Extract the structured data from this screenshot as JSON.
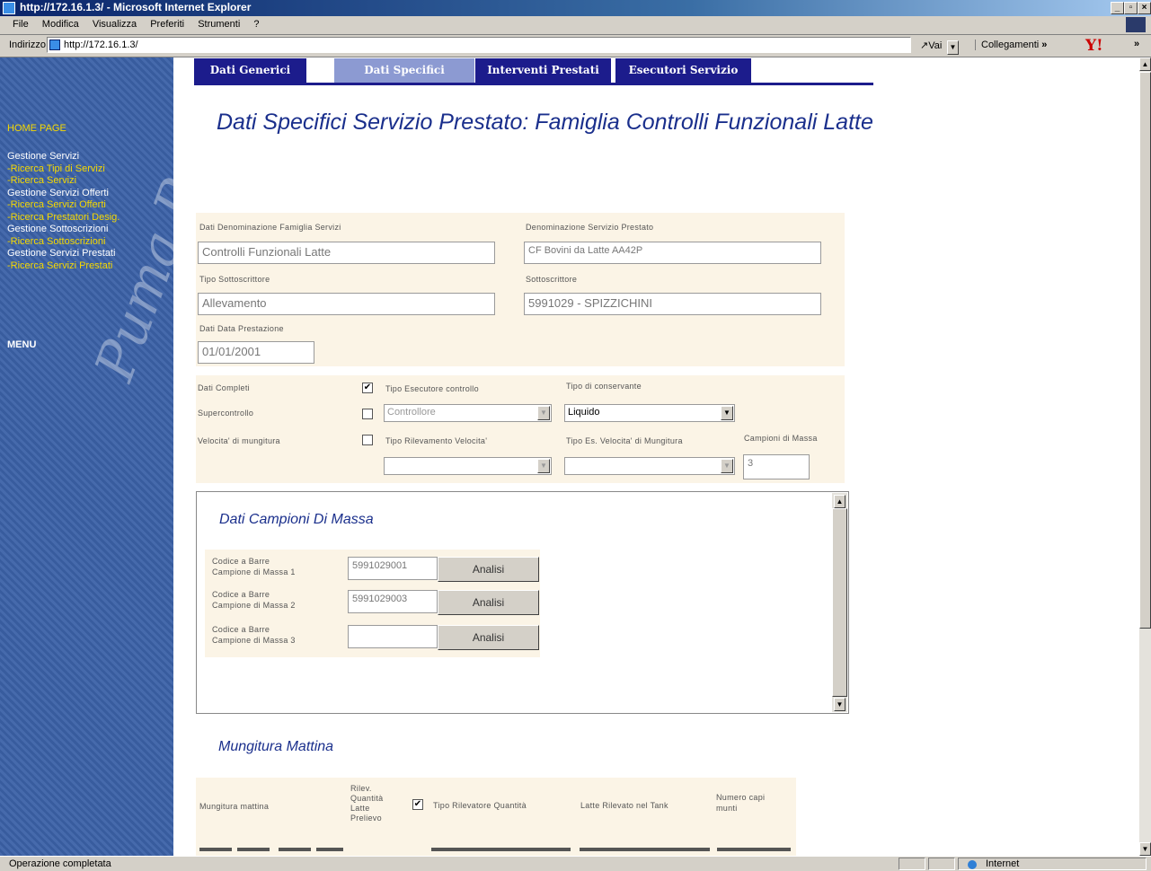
{
  "window": {
    "title": "http://172.16.1.3/ - Microsoft Internet Explorer"
  },
  "menu": [
    "File",
    "Modifica",
    "Visualizza",
    "Preferiti",
    "Strumenti",
    "?"
  ],
  "addressbar": {
    "label": "Indirizzo",
    "url": "http://172.16.1.3/",
    "go_label": "Vai",
    "links_label": "Collegamenti",
    "chevron": "»"
  },
  "sidebar": {
    "home": "HOME PAGE",
    "items": [
      {
        "label": "Gestione Servizi",
        "style": "white"
      },
      {
        "label": "-Ricerca Tipi di Servizi",
        "style": "yellow"
      },
      {
        "label": "-Ricerca Servizi",
        "style": "yellow"
      },
      {
        "label": "Gestione Servizi Offerti",
        "style": "white"
      },
      {
        "label": "-Ricerca Servizi Offerti",
        "style": "yellow"
      },
      {
        "label": "-Ricerca Prestatori Desig.",
        "style": "yellow"
      },
      {
        "label": "Gestione Sottoscrizioni",
        "style": "white"
      },
      {
        "label": "-Ricerca Sottoscrizioni",
        "style": "yellow"
      },
      {
        "label": "Gestione Servizi Prestati",
        "style": "white"
      },
      {
        "label": "-Ricerca Servizi Prestati",
        "style": "yellow"
      }
    ],
    "menu_label": "MENU",
    "watermark": "Puma Pr"
  },
  "tabs": [
    "Dati Generici",
    "Dati Specifici",
    "Interventi Prestati",
    "Esecutori Servizio"
  ],
  "page_title": "Dati Specifici Servizio Prestato: Famiglia Controlli Funzionali Latte",
  "general": {
    "famiglia_label": "Dati Denominazione Famiglia Servizi",
    "famiglia_value": "Controlli Funzionali  Latte",
    "servizio_label": "Denominazione Servizio Prestato",
    "servizio_value": "CF Bovini da Latte AA42P",
    "tipo_sott_label": "Tipo Sottoscrittore",
    "tipo_sott_value": "Allevamento",
    "sott_label": "Sottoscrittore",
    "sott_value": "5991029 - SPIZZICHINI",
    "data_label": "Dati Data Prestazione",
    "data_value": "01/01/2001"
  },
  "options": {
    "dati_completi_label": "Dati Completi",
    "dati_completi_checked": true,
    "supercontrollo_label": "Supercontrollo",
    "supercontrollo_checked": false,
    "velocita_label": "Velocita' di mungitura",
    "velocita_checked": false,
    "tipo_esecutore_label": "Tipo Esecutore controllo",
    "tipo_esecutore_value": "Controllore",
    "tipo_conservante_label": "Tipo di conservante",
    "tipo_conservante_value": "Liquido",
    "tipo_rilevamento_label": "Tipo Rilevamento Velocita'",
    "tipo_rilevamento_value": "",
    "tipo_es_vel_label": "Tipo Es. Velocita' di Mungitura",
    "tipo_es_vel_value": "",
    "campioni_label": "Campioni di Massa",
    "campioni_value": "3"
  },
  "campioni_section": {
    "title": "Dati Campioni Di Massa",
    "rows": [
      {
        "label_a": "Codice a Barre",
        "label_b": "Campione di Massa 1",
        "value": "5991029001",
        "button": "Analisi"
      },
      {
        "label_a": "Codice a Barre",
        "label_b": "Campione di Massa 2",
        "value": "5991029003",
        "button": "Analisi"
      },
      {
        "label_a": "Codice a Barre",
        "label_b": "Campione di Massa 3",
        "value": "",
        "button": "Analisi"
      }
    ]
  },
  "mungitura": {
    "title": "Mungitura Mattina",
    "col_mungitura": "Mungitura mattina",
    "col_rilev_a": "Rilev.",
    "col_rilev_b": "Quantità",
    "col_rilev_c": "Latte",
    "col_rilev_checked": true,
    "col_tipo_rilevatore": "Tipo Rilevatore Quantità",
    "col_latte_tank": "Latte Rilevato nel Tank",
    "col_numero_a": "Numero capi",
    "col_numero_b": "munti",
    "col_prelievo": "Prelievo"
  },
  "statusbar": {
    "text": "Operazione completata",
    "zone": "Internet"
  }
}
